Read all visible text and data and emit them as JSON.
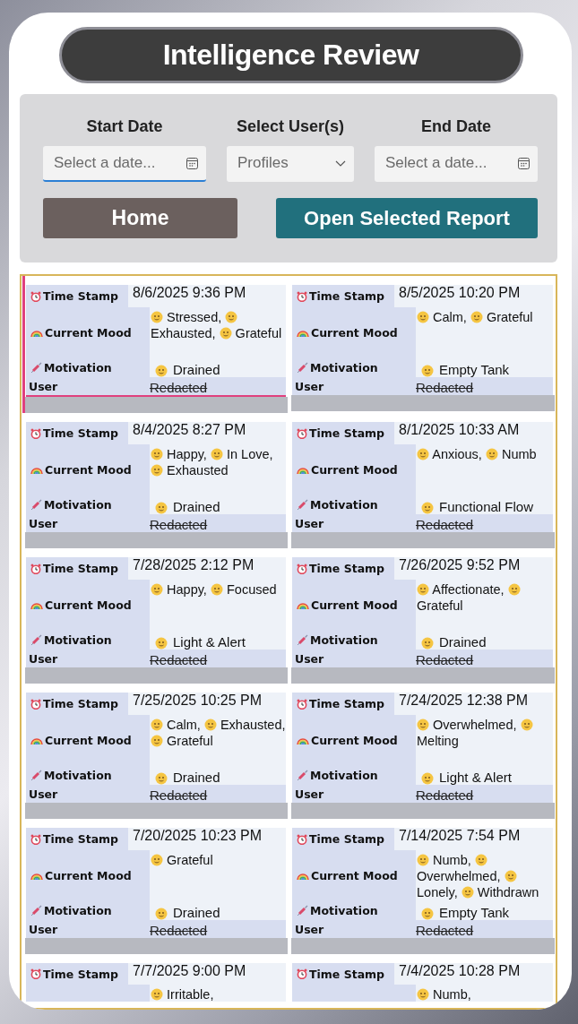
{
  "title": "Intelligence Review",
  "filters": [
    {
      "kind": "date",
      "label": "Start Date",
      "placeholder": "Select a date...",
      "focused": true
    },
    {
      "kind": "dropdown",
      "label": "Select User(s)",
      "placeholder": "Profiles",
      "focused": false
    },
    {
      "kind": "date",
      "label": "End Date",
      "placeholder": "Select a date...",
      "focused": false
    }
  ],
  "buttons": [
    {
      "kind": "home",
      "label": "Home"
    },
    {
      "kind": "open",
      "label": "Open Selected Report"
    }
  ],
  "records": [
    {
      "selected": true,
      "time_label": "Time Stamp",
      "time": "8/6/2025 9:36 PM",
      "mood_label": "Current Mood",
      "moods": [
        "Stressed,",
        "Exhausted,",
        "Grateful"
      ],
      "motivation_label": "Motivation",
      "motivation": "Drained",
      "user_label": "User",
      "user": "Redacted"
    },
    {
      "selected": false,
      "time_label": "Time Stamp",
      "time": "8/5/2025 10:20 PM",
      "mood_label": "Current Mood",
      "moods": [
        "Calm,",
        "Grateful"
      ],
      "motivation_label": "Motivation",
      "motivation": "Empty Tank",
      "user_label": "User",
      "user": "Redacted"
    },
    {
      "selected": false,
      "time_label": "Time Stamp",
      "time": "8/4/2025 8:27 PM",
      "mood_label": "Current Mood",
      "moods": [
        "Happy,",
        "In Love,",
        "Exhausted"
      ],
      "motivation_label": "Motivation",
      "motivation": "Drained",
      "user_label": "User",
      "user": "Redacted"
    },
    {
      "selected": false,
      "time_label": "Time Stamp",
      "time": "8/1/2025 10:33 AM",
      "mood_label": "Current Mood",
      "moods": [
        "Anxious,",
        "Numb"
      ],
      "motivation_label": "Motivation",
      "motivation": "Functional Flow",
      "user_label": "User",
      "user": "Redacted"
    },
    {
      "selected": false,
      "time_label": "Time Stamp",
      "time": "7/28/2025 2:12 PM",
      "mood_label": "Current Mood",
      "moods": [
        "Happy,",
        "Focused"
      ],
      "motivation_label": "Motivation",
      "motivation": "Light & Alert",
      "user_label": "User",
      "user": "Redacted"
    },
    {
      "selected": false,
      "time_label": "Time Stamp",
      "time": "7/26/2025 9:52 PM",
      "mood_label": "Current Mood",
      "moods": [
        "Affectionate,",
        "Grateful"
      ],
      "motivation_label": "Motivation",
      "motivation": "Drained",
      "user_label": "User",
      "user": "Redacted"
    },
    {
      "selected": false,
      "time_label": "Time Stamp",
      "time": "7/25/2025 10:25 PM",
      "mood_label": "Current Mood",
      "moods": [
        "Calm,",
        "Exhausted,",
        "Grateful"
      ],
      "motivation_label": "Motivation",
      "motivation": "Drained",
      "user_label": "User",
      "user": "Redacted"
    },
    {
      "selected": false,
      "time_label": "Time Stamp",
      "time": "7/24/2025 12:38 PM",
      "mood_label": "Current Mood",
      "moods": [
        "Overwhelmed,",
        "Melting"
      ],
      "motivation_label": "Motivation",
      "motivation": "Light & Alert",
      "user_label": "User",
      "user": "Redacted"
    },
    {
      "selected": false,
      "time_label": "Time Stamp",
      "time": "7/20/2025 10:23 PM",
      "mood_label": "Current Mood",
      "moods": [
        "Grateful"
      ],
      "motivation_label": "Motivation",
      "motivation": "Drained",
      "user_label": "User",
      "user": "Redacted"
    },
    {
      "selected": false,
      "time_label": "Time Stamp",
      "time": "7/14/2025 7:54 PM",
      "mood_label": "Current Mood",
      "moods": [
        "Numb,",
        "Overwhelmed,",
        "Lonely,",
        "Withdrawn"
      ],
      "motivation_label": "Motivation",
      "motivation": "Empty Tank",
      "user_label": "User",
      "user": "Redacted"
    },
    {
      "selected": false,
      "time_label": "Time Stamp",
      "time": "7/7/2025 9:00 PM",
      "moods": [
        "Irritable,"
      ]
    },
    {
      "selected": false,
      "time_label": "Time Stamp",
      "time": "7/4/2025 10:28 PM",
      "moods": [
        "Numb,"
      ]
    }
  ]
}
